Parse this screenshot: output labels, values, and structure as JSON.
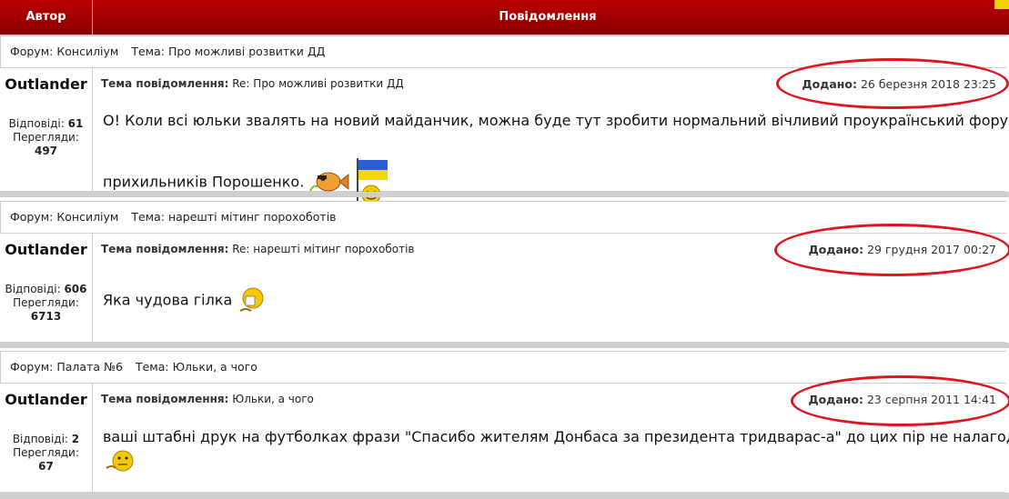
{
  "header": {
    "author_col": "Автор",
    "message_col": "Повідомлення"
  },
  "posts": [
    {
      "forum_label": "Форум:",
      "forum": "Консиліум",
      "topic_label": "Тема:",
      "topic": "Про можливі розвитки ДД",
      "author": "Outlander",
      "subject_label": "Тема повідомлення:",
      "subject": "Re: Про можливі розвитки ДД",
      "date_label": "Додано:",
      "date": "26 березня 2018 23:25",
      "replies_label": "Відповіді:",
      "replies": "61",
      "views_label": "Перегляди:",
      "views": "497",
      "text": "О! Коли всі юльки звалять на новий майданчик, можна буде тут зробити нормальний вічливий проукраїнський форум",
      "text2": "прихильників Порошенко.",
      "smilies": [
        "fish-smiley-icon",
        "flag-smiley-icon"
      ]
    },
    {
      "forum_label": "Форум:",
      "forum": "Консиліум",
      "topic_label": "Тема:",
      "topic": "нарешті мітинг порохоботів",
      "author": "Outlander",
      "subject_label": "Тема повідомлення:",
      "subject": "Re: нарешті мітинг порохоботів",
      "date_label": "Додано:",
      "date": "29 грудня 2017 00:27",
      "replies_label": "Відповіді:",
      "replies": "606",
      "views_label": "Перегляди:",
      "views": "6713",
      "text": "Яка чудова гілка",
      "smilies": [
        "reading-smiley-icon"
      ]
    },
    {
      "forum_label": "Форум:",
      "forum": "Палата №6",
      "topic_label": "Тема:",
      "topic": "Юльки, а чого",
      "author": "Outlander",
      "subject_label": "Тема повідомлення:",
      "subject": "Юльки, а чого",
      "date_label": "Додано:",
      "date": "23 серпня 2011 14:41",
      "replies_label": "Відповіді:",
      "replies": "2",
      "views_label": "Перегляди:",
      "views": "67",
      "text": "ваші штабні друк на футболках фрази \"Спасибо жителям Донбаса за президента тридварас-а\" до цих пір не налагодили?",
      "smilies": [
        "thinking-smiley-icon"
      ]
    }
  ],
  "colors": {
    "header_red": "#a00000",
    "highlight_ring": "#e0141e"
  }
}
